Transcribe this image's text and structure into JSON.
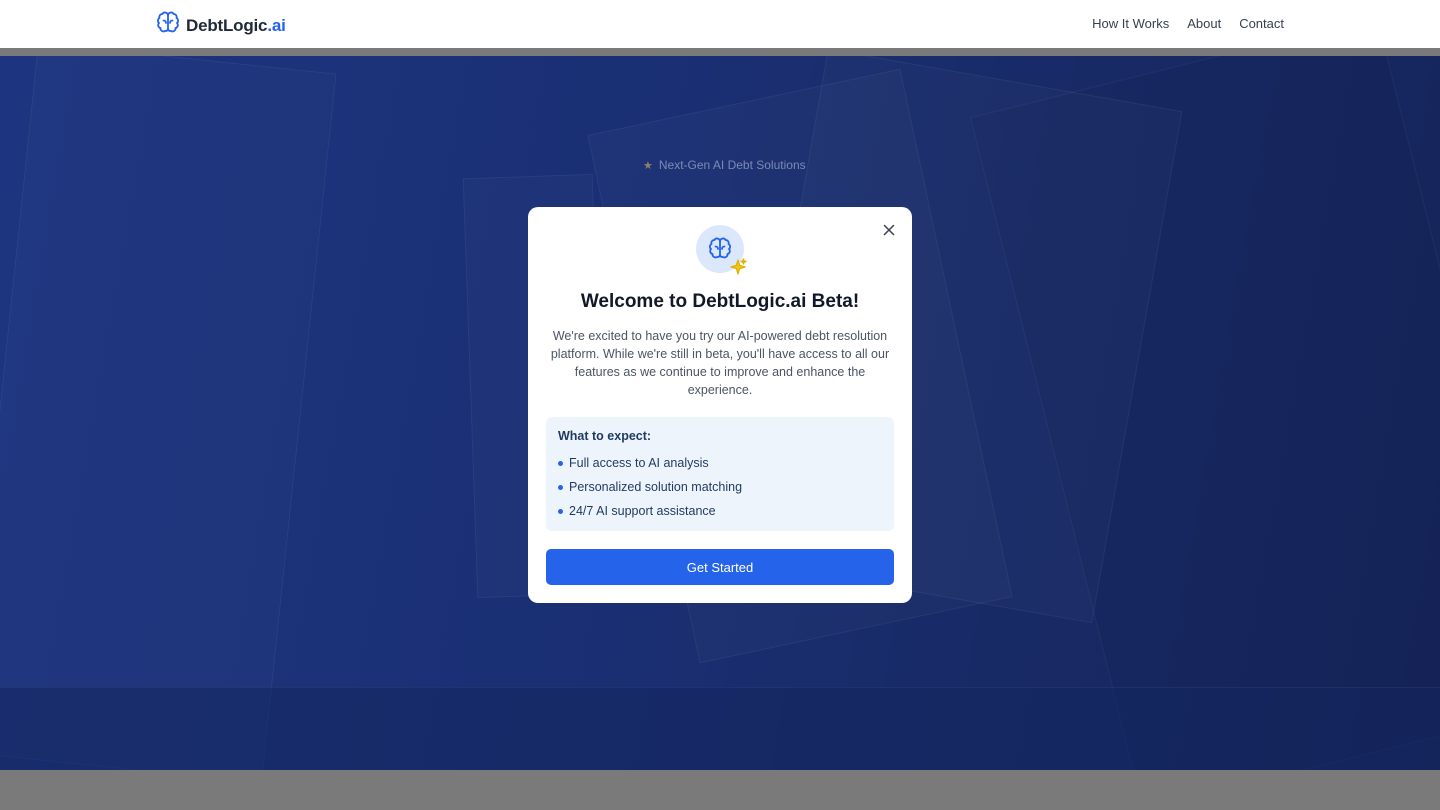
{
  "nav": {
    "brand_main": "DebtLogic",
    "brand_suffix": ".ai",
    "links": [
      {
        "label": "How It Works"
      },
      {
        "label": "About"
      },
      {
        "label": "Contact"
      }
    ]
  },
  "hero": {
    "badge": "Next-Gen AI Debt Solutions"
  },
  "modal": {
    "title": "Welcome to DebtLogic.ai Beta!",
    "description": "We're excited to have you try our AI-powered debt resolution platform. While we're still in beta, you'll have access to all our features as we continue to improve and enhance the experience.",
    "expect_title": "What to expect:",
    "expect_items": [
      "Full access to AI analysis",
      "Personalized solution matching",
      "24/7 AI support assistance"
    ],
    "cta_label": "Get Started"
  },
  "colors": {
    "accent": "#2563eb",
    "hero_overlay": "#1a2f73",
    "sparkle": "#f5c518"
  },
  "icons": {
    "brand": "brain-icon",
    "modal": "brain-icon",
    "sparkle": "sparkles-icon",
    "close": "close-icon"
  }
}
